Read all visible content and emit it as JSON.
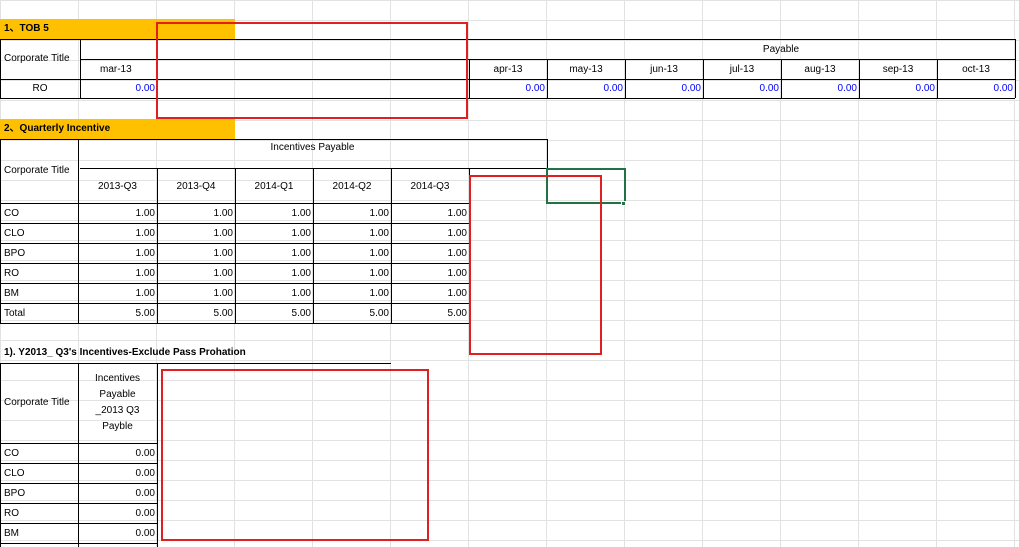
{
  "section1": {
    "heading": "1、TOB 5",
    "corporate_title": "Corporate Title",
    "payable_label": "Payable",
    "months": [
      "mar-13",
      "apr-13",
      "may-13",
      "jun-13",
      "jul-13",
      "aug-13",
      "sep-13",
      "oct-13"
    ],
    "row": {
      "label": "RO",
      "values": [
        "0.00",
        "0.00",
        "0.00",
        "0.00",
        "0.00",
        "0.00",
        "0.00",
        "0.00"
      ]
    }
  },
  "section2": {
    "heading": "2、Quarterly Incentive",
    "corporate_title": "Corporate Title",
    "incentives_label": "Incentives Payable",
    "quarters": [
      "2013-Q3",
      "2013-Q4",
      "2014-Q1",
      "2014-Q2",
      "2014-Q3"
    ],
    "rows": [
      {
        "label": "CO",
        "values": [
          "1.00",
          "1.00",
          "1.00",
          "1.00",
          "1.00"
        ]
      },
      {
        "label": "CLO",
        "values": [
          "1.00",
          "1.00",
          "1.00",
          "1.00",
          "1.00"
        ]
      },
      {
        "label": "BPO",
        "values": [
          "1.00",
          "1.00",
          "1.00",
          "1.00",
          "1.00"
        ]
      },
      {
        "label": "RO",
        "values": [
          "1.00",
          "1.00",
          "1.00",
          "1.00",
          "1.00"
        ]
      },
      {
        "label": "BM",
        "values": [
          "1.00",
          "1.00",
          "1.00",
          "1.00",
          "1.00"
        ]
      },
      {
        "label": "Total",
        "values": [
          "5.00",
          "5.00",
          "5.00",
          "5.00",
          "5.00"
        ]
      }
    ]
  },
  "section3": {
    "heading": "1). Y2013_ Q3's Incentives-Exclude Pass Prohation",
    "corporate_title": "Corporate Title",
    "header_lines": [
      "Incentives",
      "Payable",
      "_2013 Q3",
      "Payble"
    ],
    "rows": [
      {
        "label": "CO",
        "value": "0.00"
      },
      {
        "label": "CLO",
        "value": "0.00"
      },
      {
        "label": "BPO",
        "value": "0.00"
      },
      {
        "label": "RO",
        "value": "0.00"
      },
      {
        "label": "BM",
        "value": "0.00"
      }
    ]
  },
  "colors": {
    "highlight": "#ffc000",
    "annotation": "#e02020",
    "selection": "#217346",
    "value_text": "#0000ff"
  }
}
